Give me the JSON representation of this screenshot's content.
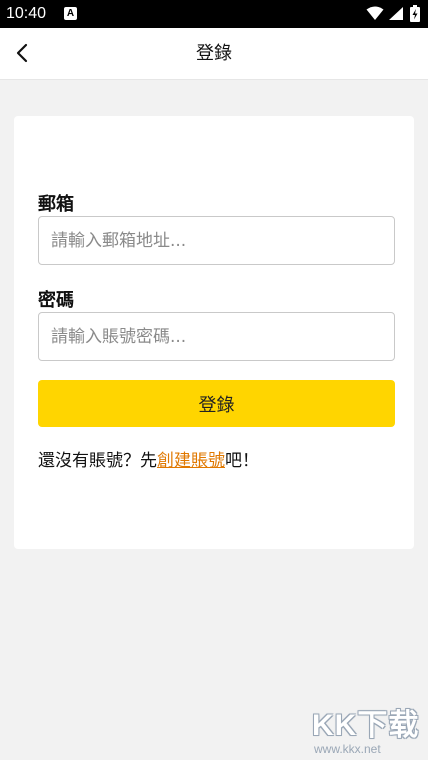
{
  "status_bar": {
    "time": "10:40",
    "notification_icon": "A"
  },
  "header": {
    "title": "登錄",
    "back_icon": "chevron-left-icon"
  },
  "form": {
    "email_label": "郵箱",
    "email_placeholder": "請輸入郵箱地址...",
    "email_value": "",
    "password_label": "密碼",
    "password_placeholder": "請輸入賬號密碼...",
    "password_value": "",
    "submit_label": "登錄",
    "signup_prefix": "還沒有賬號？先",
    "signup_link": "創建賬號",
    "signup_suffix": "吧！"
  },
  "watermark": {
    "logo": "KK下载",
    "url": "www.kkx.net"
  },
  "colors": {
    "accent": "#ffd500",
    "link": "#e07800",
    "background": "#f2f2f2"
  }
}
